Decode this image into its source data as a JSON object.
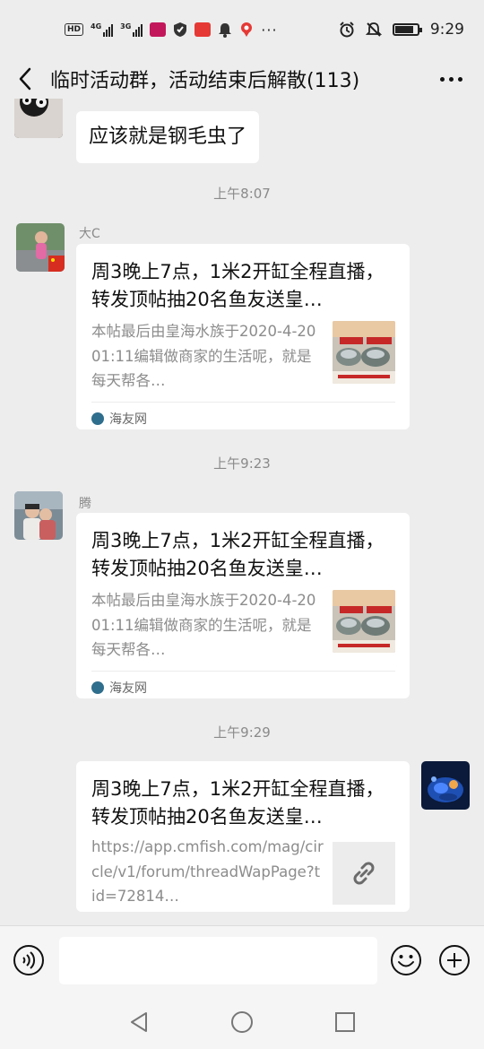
{
  "status_bar": {
    "left_badges": [
      "HD",
      "4G",
      "3G"
    ],
    "time": "9:29"
  },
  "header": {
    "title": "临时活动群，活动结束后解散(113)"
  },
  "chat": {
    "partial_message": "应该就是钢毛虫了",
    "timestamps": [
      "上午8:07",
      "上午9:23",
      "上午9:29"
    ],
    "messages": [
      {
        "sender": "大C",
        "title": "周3晚上7点，1米2开缸全程直播，转发顶帖抽20名鱼友送皇…",
        "desc": "本帖最后由皇海水族于2020-4-2001:11编辑做商家的生活呢，就是每天帮各…",
        "source": "海友网"
      },
      {
        "sender": "腾",
        "title": "周3晚上7点，1米2开缸全程直播，转发顶帖抽20名鱼友送皇…",
        "desc": "本帖最后由皇海水族于2020-4-2001:11编辑做商家的生活呢，就是每天帮各…",
        "source": "海友网"
      },
      {
        "sender": "",
        "title": "周3晚上7点，1米2开缸全程直播，转发顶帖抽20名鱼友送皇…",
        "desc": "https://app.cmfish.com/mag/circle/v1/forum/threadWapPage?tid=72814…"
      }
    ]
  },
  "colors": {
    "background": "#ededed",
    "bubble": "#ffffff",
    "muted_text": "#8a8a8a"
  }
}
